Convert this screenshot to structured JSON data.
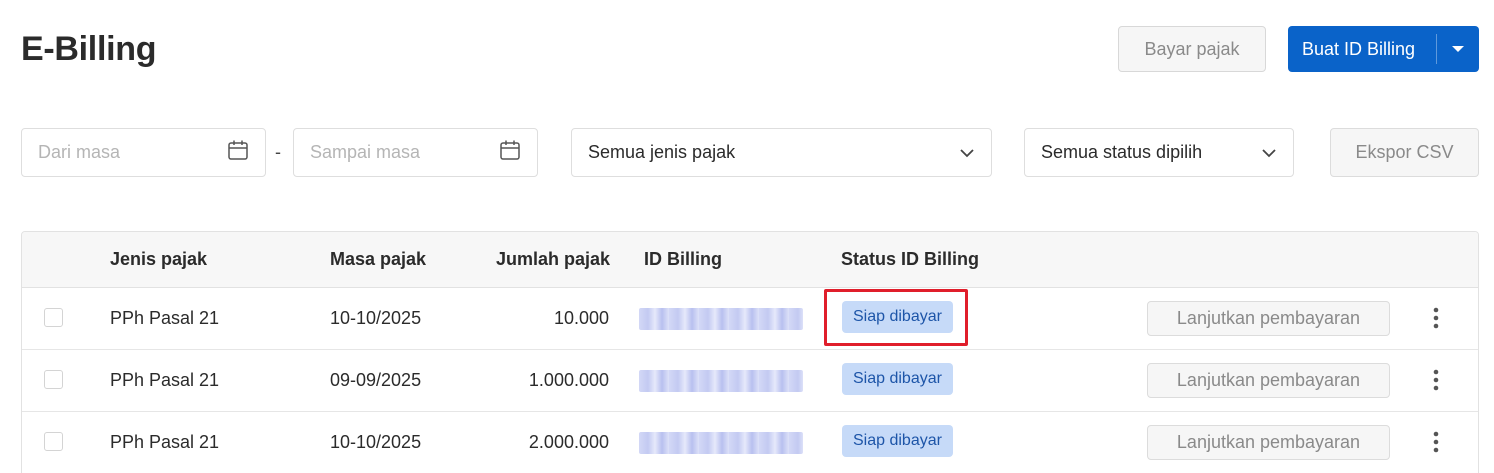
{
  "page": {
    "title": "E-Billing"
  },
  "toolbar": {
    "pay_label": "Bayar pajak",
    "create_label": "Buat ID Billing"
  },
  "filters": {
    "date_from_placeholder": "Dari masa",
    "separator": "-",
    "date_to_placeholder": "Sampai masa",
    "tax_type_selected": "Semua jenis pajak",
    "status_selected": "Semua status dipilih",
    "export_label": "Ekspor CSV"
  },
  "table": {
    "headers": [
      "",
      "Jenis pajak",
      "Masa pajak",
      "Jumlah pajak",
      "ID Billing",
      "Status ID Billing"
    ],
    "rows": [
      {
        "type": "PPh Pasal 21",
        "period": "10-10/2025",
        "amount": "10.000",
        "status": "Siap dibayar",
        "action": "Lanjutkan pembayaran"
      },
      {
        "type": "PPh Pasal 21",
        "period": "09-09/2025",
        "amount": "1.000.000",
        "status": "Siap dibayar",
        "action": "Lanjutkan pembayaran"
      },
      {
        "type": "PPh Pasal 21",
        "period": "10-10/2025",
        "amount": "2.000.000",
        "status": "Siap dibayar",
        "action": "Lanjutkan pembayaran"
      }
    ]
  },
  "colors": {
    "primary": "#0a63c9",
    "badge_bg": "#c6daf8",
    "badge_text": "#1d55a8",
    "highlight": "#e01e2b"
  },
  "icons": {
    "date": "calendar-icon",
    "select": "chevron-down-icon",
    "split": "caret-down-icon",
    "menu": "more-vertical-icon"
  }
}
